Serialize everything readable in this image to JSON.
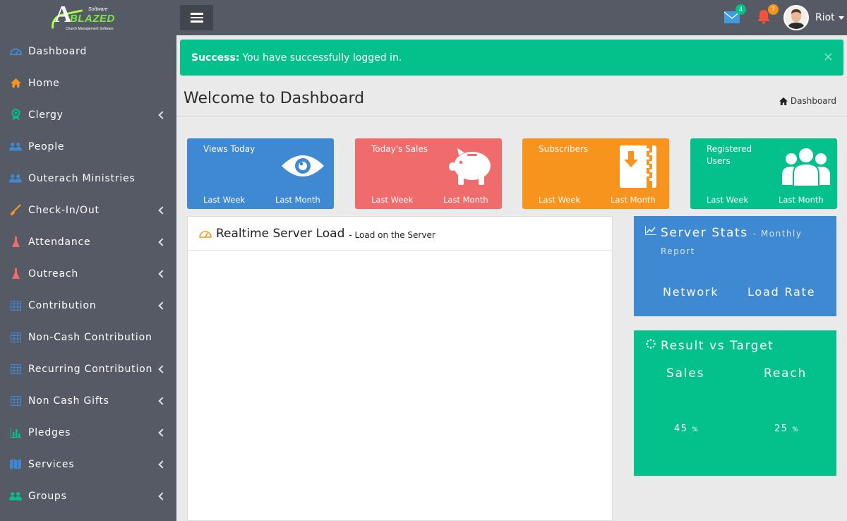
{
  "brand": {
    "logo_letter": "A",
    "logo_word": "BLAZED",
    "logo_software": "Software",
    "logo_tagline": "Church Management Software"
  },
  "sidebar": {
    "items": [
      {
        "label": "Dashboard",
        "icon": "dashboard-icon",
        "color": "#3f88d2",
        "has_sub": false
      },
      {
        "label": "Home",
        "icon": "home-icon",
        "color": "#f7941d",
        "has_sub": false
      },
      {
        "label": "Clergy",
        "icon": "badge-icon",
        "color": "#04c08b",
        "has_sub": true
      },
      {
        "label": "People",
        "icon": "people-icon",
        "color": "#3f88d2",
        "has_sub": false
      },
      {
        "label": "Outerach Ministries",
        "icon": "people-icon",
        "color": "#3f88d2",
        "has_sub": false
      },
      {
        "label": "Check-In/Out",
        "icon": "brush-icon",
        "color": "#f7941d",
        "has_sub": true
      },
      {
        "label": "Attendance",
        "icon": "flask-icon",
        "color": "#f06b6b",
        "has_sub": true
      },
      {
        "label": "Outreach",
        "icon": "flask-icon",
        "color": "#f06b6b",
        "has_sub": true
      },
      {
        "label": "Contribution",
        "icon": "table-icon",
        "color": "#3f88d2",
        "has_sub": true
      },
      {
        "label": "Non-Cash Contribution",
        "icon": "table-icon",
        "color": "#3f88d2",
        "has_sub": false
      },
      {
        "label": "Recurring Contribution",
        "icon": "table-icon",
        "color": "#3f88d2",
        "has_sub": true
      },
      {
        "label": "Non Cash Gifts",
        "icon": "table-icon",
        "color": "#3f88d2",
        "has_sub": true
      },
      {
        "label": "Pledges",
        "icon": "bar-chart-icon",
        "color": "#04c08b",
        "has_sub": true
      },
      {
        "label": "Services",
        "icon": "map-icon",
        "color": "#3f88d2",
        "has_sub": true
      },
      {
        "label": "Groups",
        "icon": "people-icon",
        "color": "#04c08b",
        "has_sub": true
      }
    ]
  },
  "topbar": {
    "messages_count": "4",
    "notifications_count": "7",
    "user_name": "Riot"
  },
  "alert": {
    "strong": "Success:",
    "message": "You have successfully logged in.",
    "close": "×"
  },
  "page": {
    "title": "Welcome to Dashboard",
    "breadcrumb": "Dashboard"
  },
  "tiles": [
    {
      "title": "Views Today",
      "last_week": "Last Week",
      "last_month": "Last Month",
      "color": "#3f88d2",
      "icon": "eye-icon"
    },
    {
      "title": "Today's Sales",
      "last_week": "Last Week",
      "last_month": "Last Month",
      "color": "#f06b6b",
      "icon": "piggy-bank-icon"
    },
    {
      "title": "Subscribers",
      "last_week": "Last Week",
      "last_month": "Last Month",
      "color": "#f7941d",
      "icon": "download-file-icon"
    },
    {
      "title": "Registered Users",
      "last_week": "Last Week",
      "last_month": "Last Month",
      "color": "#04c08b",
      "icon": "users-icon"
    }
  ],
  "server_load": {
    "title": "Realtime Server Load",
    "subtitle": "- Load on the Server"
  },
  "server_stats": {
    "title": "Server Stats",
    "subtitle": "- Monthly Report",
    "labels": [
      "Network",
      "Load Rate"
    ]
  },
  "result_target": {
    "title": "Result vs Target",
    "items": [
      {
        "label": "Sales",
        "value": "45",
        "unit": "%"
      },
      {
        "label": "Reach",
        "value": "25",
        "unit": "%"
      }
    ]
  }
}
